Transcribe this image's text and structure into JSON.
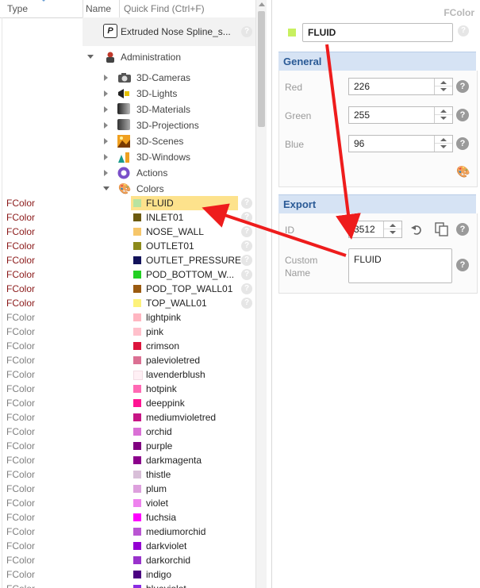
{
  "left_header": {
    "type_label": "Type",
    "name_label": "Name",
    "search_placeholder": "Quick Find (Ctrl+F)"
  },
  "tree": {
    "spline_label": "Extruded Nose Spline_s...",
    "administration": "Administration",
    "children": [
      "3D-Cameras",
      "3D-Lights",
      "3D-Materials",
      "3D-Projections",
      "3D-Scenes",
      "3D-Windows",
      "Actions"
    ],
    "colors": "Colors"
  },
  "color_rows": [
    {
      "type": "FColor",
      "name": "FLUID",
      "color": "#b8e3a0",
      "user": true,
      "selected": true
    },
    {
      "type": "FColor",
      "name": "INLET01",
      "color": "#6b5a10",
      "user": true
    },
    {
      "type": "FColor",
      "name": "NOSE_WALL",
      "color": "#f6c66a",
      "user": true
    },
    {
      "type": "FColor",
      "name": "OUTLET01",
      "color": "#8c8a1a",
      "user": true
    },
    {
      "type": "FColor",
      "name": "OUTLET_PRESSURE",
      "color": "#12125a",
      "user": true
    },
    {
      "type": "FColor",
      "name": "POD_BOTTOM_W...",
      "color": "#22d022",
      "user": true
    },
    {
      "type": "FColor",
      "name": "POD_TOP_WALL01",
      "color": "#9a5a10",
      "user": true
    },
    {
      "type": "FColor",
      "name": "TOP_WALL01",
      "color": "#fdf27a",
      "user": true
    },
    {
      "type": "FColor",
      "name": "lightpink",
      "color": "#ffb6c1"
    },
    {
      "type": "FColor",
      "name": "pink",
      "color": "#ffc0cb"
    },
    {
      "type": "FColor",
      "name": "crimson",
      "color": "#dc143c"
    },
    {
      "type": "FColor",
      "name": "palevioletred",
      "color": "#db7093"
    },
    {
      "type": "FColor",
      "name": "lavenderblush",
      "color": "#fff0f5"
    },
    {
      "type": "FColor",
      "name": "hotpink",
      "color": "#ff69b4"
    },
    {
      "type": "FColor",
      "name": "deeppink",
      "color": "#ff1493"
    },
    {
      "type": "FColor",
      "name": "mediumvioletred",
      "color": "#c71585"
    },
    {
      "type": "FColor",
      "name": "orchid",
      "color": "#da70d6"
    },
    {
      "type": "FColor",
      "name": "purple",
      "color": "#800080"
    },
    {
      "type": "FColor",
      "name": "darkmagenta",
      "color": "#8b008b"
    },
    {
      "type": "FColor",
      "name": "thistle",
      "color": "#d8bfd8"
    },
    {
      "type": "FColor",
      "name": "plum",
      "color": "#dda0dd"
    },
    {
      "type": "FColor",
      "name": "violet",
      "color": "#ee82ee"
    },
    {
      "type": "FColor",
      "name": "fuchsia",
      "color": "#ff00ff"
    },
    {
      "type": "FColor",
      "name": "mediumorchid",
      "color": "#ba55d3"
    },
    {
      "type": "FColor",
      "name": "darkviolet",
      "color": "#9400d3"
    },
    {
      "type": "FColor",
      "name": "darkorchid",
      "color": "#9932cc"
    },
    {
      "type": "FColor",
      "name": "indigo",
      "color": "#4b0082"
    },
    {
      "type": "FColor",
      "name": "blueviolet",
      "color": "#8a2be2"
    }
  ],
  "panel": {
    "title": "FColor",
    "name_value": "FLUID",
    "swatch_color": "#c8f060",
    "general": {
      "header": "General",
      "red_label": "Red",
      "red": "226",
      "green_label": "Green",
      "green": "255",
      "blue_label": "Blue",
      "blue": "96"
    },
    "export": {
      "header": "Export",
      "id_label": "ID",
      "id_value": "3512",
      "custom_name_label_1": "Custom",
      "custom_name_label_2": "Name",
      "custom_name_value": "FLUID"
    }
  },
  "icons": {
    "help": "?",
    "undo": "undo-icon",
    "copy": "copy-icon",
    "palette": "palette-icon",
    "annotation_color": "#ee1c1c"
  }
}
